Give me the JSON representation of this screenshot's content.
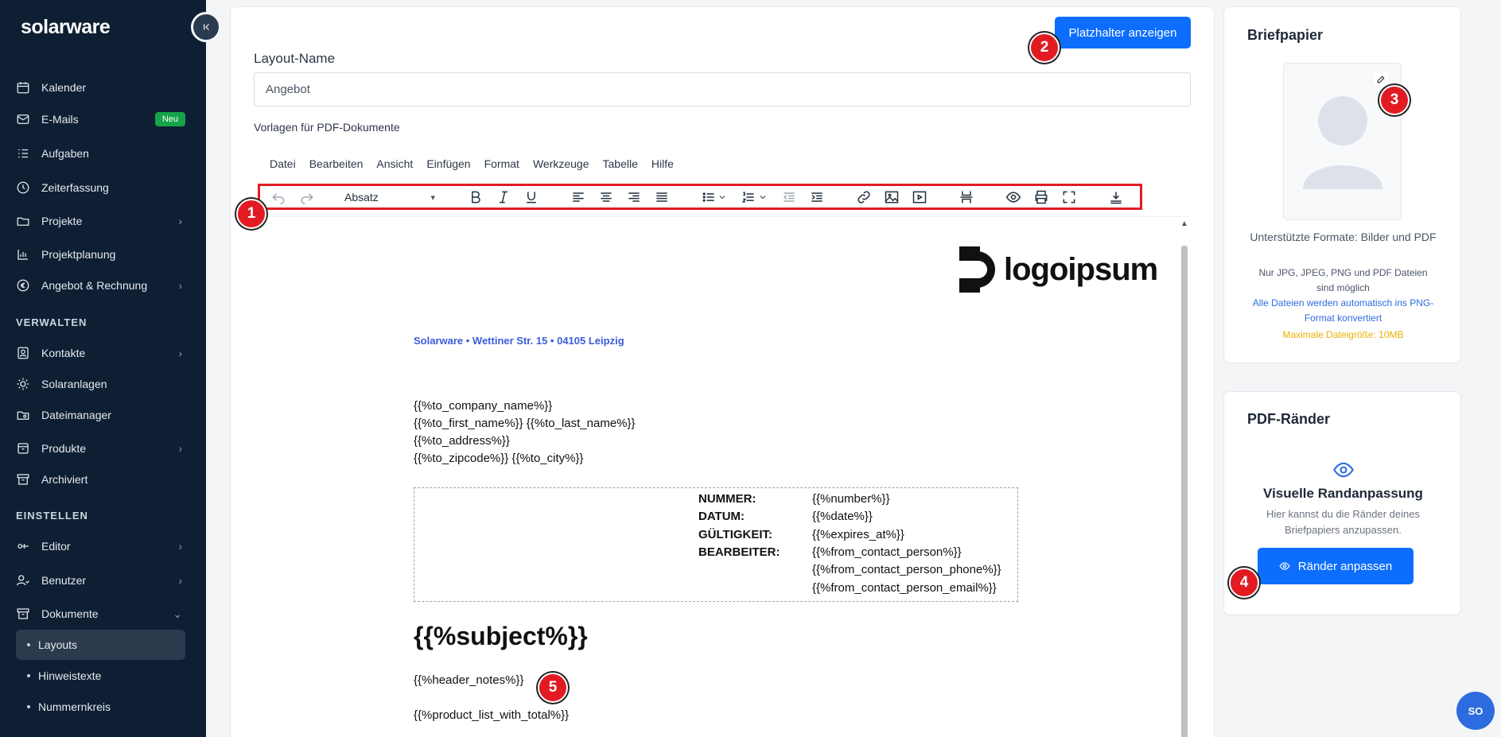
{
  "app": {
    "logo": "solarware"
  },
  "sidebar": {
    "items": [
      {
        "label": "Kalender",
        "icon": "calendar-icon"
      },
      {
        "label": "E-Mails",
        "icon": "mail-icon",
        "badge": "Neu"
      },
      {
        "label": "Aufgaben",
        "icon": "tasks-icon"
      },
      {
        "label": "Zeiterfassung",
        "icon": "clock-icon"
      },
      {
        "label": "Projekte",
        "icon": "folder-icon"
      },
      {
        "label": "Projektplanung",
        "icon": "chart-icon"
      },
      {
        "label": "Angebot & Rechnung",
        "icon": "euro-icon"
      }
    ],
    "section_manage": "VERWALTEN",
    "manage_items": [
      {
        "label": "Kontakte",
        "icon": "contacts-icon"
      },
      {
        "label": "Solaranlagen",
        "icon": "sun-icon"
      },
      {
        "label": "Dateimanager",
        "icon": "folder-search-icon"
      },
      {
        "label": "Produkte",
        "icon": "box-icon"
      },
      {
        "label": "Archiviert",
        "icon": "archive-icon"
      }
    ],
    "section_settings": "EINSTELLEN",
    "settings_items": [
      {
        "label": "Editor",
        "icon": "editor-icon"
      },
      {
        "label": "Benutzer",
        "icon": "users-icon"
      },
      {
        "label": "Dokumente",
        "icon": "documents-icon"
      }
    ],
    "doc_subitems": [
      "Layouts",
      "Hinweistexte",
      "Nummernkreis"
    ]
  },
  "main": {
    "placeholder_button": "Platzhalter anzeigen",
    "layout_name_label": "Layout-Name",
    "layout_name_value": "Angebot",
    "templates_label": "Vorlagen für PDF-Dokumente",
    "menu": [
      "Datei",
      "Bearbeiten",
      "Ansicht",
      "Einfügen",
      "Format",
      "Werkzeuge",
      "Tabelle",
      "Hilfe"
    ],
    "format_select": "Absatz"
  },
  "document": {
    "logo_text": "logoipsum",
    "sender": "Solarware • Wettiner Str. 15 • 04105 Leipzig",
    "address": [
      "{{%to_company_name%}}",
      "{{%to_first_name%}} {{%to_last_name%}}",
      "{{%to_address%}}",
      "{{%to_zipcode%}} {{%to_city%}}"
    ],
    "info": [
      {
        "key": "NUMMER:",
        "value": "{{%number%}}"
      },
      {
        "key": "DATUM:",
        "value": "{{%date%}}"
      },
      {
        "key": "GÜLTIGKEIT:",
        "value": "{{%expires_at%}}"
      },
      {
        "key": "BEARBEITER:",
        "value": "{{%from_contact_person%}}"
      },
      {
        "key": "",
        "value": "{{%from_contact_person_phone%}}"
      },
      {
        "key": "",
        "value": "{{%from_contact_person_email%}}"
      }
    ],
    "subject": "{{%subject%}}",
    "header_notes": "{{%header_notes%}}",
    "product_list": "{{%product_list_with_total%}}"
  },
  "letterhead": {
    "title": "Briefpapier",
    "formats": "Unterstützte Formate: Bilder und PDF",
    "allowed": "Nur JPG, JPEG, PNG und PDF Dateien sind möglich",
    "convert_note": "Alle Dateien werden automatisch ins PNG-Format konvertiert",
    "max_size": "Maximale Dateigröße: 10MB",
    "link_color": "#2d6cdf",
    "warn_color": "#e9b000"
  },
  "margins": {
    "title": "PDF-Ränder",
    "subtitle": "Visuelle Randanpassung",
    "description": "Hier kannst du die Ränder deines Briefpapiers anzupassen.",
    "button": "Ränder anpassen"
  },
  "markers": [
    "1",
    "2",
    "3",
    "4",
    "5"
  ],
  "chat": {
    "initials": "SO"
  }
}
